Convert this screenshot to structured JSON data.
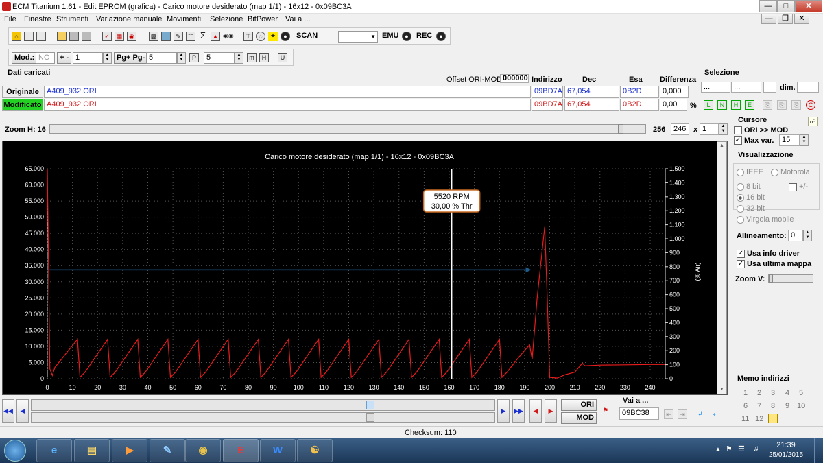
{
  "window": {
    "title": "ECM Titanium 1.61 - Edit EPROM (grafica) - Carico motore desiderato (map 1/1) - 16x12 - 0x09BC3A"
  },
  "menu": [
    "File",
    "Finestre",
    "Strumenti",
    "Variazione manuale",
    "Movimenti",
    "Selezione",
    "BitPower",
    "Vai a ..."
  ],
  "toolbar1": {
    "scan_label": "SCAN",
    "emu_label": "EMU",
    "rec_label": "REC"
  },
  "toolbar2": {
    "mod_label": "Mod.:",
    "mod_value": "NO",
    "plusminus_label": "+ -",
    "plusminus_value": "1",
    "pg_label": "Pg+ Pg-",
    "pg_value": "5",
    "p_value": "5"
  },
  "loaded": {
    "title": "Dati caricati",
    "offset_label": "Offset ORI-MOD",
    "offset_value": "000000",
    "col_address": "Indirizzo",
    "col_dec": "Dec",
    "col_hex": "Esa",
    "col_diff": "Differenza",
    "orig_label": "Originale",
    "orig_file": "A409_932.ORI",
    "orig_address": "09BD7A",
    "orig_dec": "67,054",
    "orig_hex": "0B2D",
    "orig_diff": "0,000",
    "mod_label": "Modificato",
    "mod_file": "A409_932.ORI",
    "mod_address": "09BD7A",
    "mod_dec": "67,054",
    "mod_hex": "0B2D",
    "mod_diff": "0,00",
    "mod_unit": "%"
  },
  "selection": {
    "title": "Selezione",
    "f1": "...",
    "f2": "...",
    "dim_label": "dim."
  },
  "zoom": {
    "label": "Zoom H: 16",
    "value_a": "256",
    "value_b": "246",
    "x_label": "x",
    "mult": "1"
  },
  "cursor": {
    "title": "Cursore",
    "ori_mod_label": "ORI >> MOD",
    "max_var_label": "Max var.",
    "max_var_value": "15"
  },
  "view": {
    "title": "Visualizzazione",
    "ieee": "IEEE",
    "motorola": "Motorola",
    "bit8": "8 bit",
    "plusminus": "+/-",
    "bit16": "16 bit",
    "bit32": "32 bit",
    "float": "Virgola mobile",
    "align_label": "Allineamento:",
    "align_value": "0",
    "driver_info": "Usa info driver",
    "last_map": "Usa ultima mappa",
    "zoomv_label": "Zoom V:"
  },
  "memo": {
    "title": "Memo indirizzi",
    "items": [
      "1",
      "2",
      "3",
      "4",
      "5",
      "6",
      "7",
      "8",
      "9",
      "10",
      "11",
      "12"
    ]
  },
  "bottom": {
    "vai_label": "Vai a ...",
    "vai_value": "09BC38",
    "ori_btn": "ORI",
    "mod_btn": "MOD",
    "x_min": "210",
    "checksum": "Checksum: 110"
  },
  "taskbar": {
    "time": "21:39",
    "date": "25/01/2015"
  },
  "chart_data": {
    "type": "line",
    "title": "Carico motore desiderato (map 1/1) - 16x12 - 0x09BC3A",
    "xlabel": "",
    "ylabel": "",
    "y2label": "(% Air)",
    "xlim": [
      0,
      246
    ],
    "ylim": [
      0,
      65000
    ],
    "y2lim": [
      0,
      1500
    ],
    "x_ticks": [
      "0",
      "10",
      "20",
      "30",
      "40",
      "50",
      "60",
      "70",
      "80",
      "90",
      "100",
      "110",
      "120",
      "130",
      "140",
      "150",
      "160",
      "170",
      "180",
      "190",
      "200",
      "210",
      "220",
      "230",
      "240"
    ],
    "y_ticks": [
      "0",
      "5.000",
      "10.000",
      "15.000",
      "20.000",
      "25.000",
      "30.000",
      "35.000",
      "40.000",
      "45.000",
      "50.000",
      "55.000",
      "60.000",
      "65.000"
    ],
    "y2_ticks": [
      "0",
      "100",
      "200",
      "300",
      "400",
      "500",
      "600",
      "700",
      "800",
      "900",
      "1.000",
      "1.100",
      "1.200",
      "1.300",
      "1.400",
      "1.500"
    ],
    "cursor": {
      "x": 161,
      "label_rpm": "5520 RPM",
      "label_thr": "30,00 % Thr"
    },
    "reference_line": {
      "y": 33700,
      "x_end": 191
    },
    "series": [
      {
        "color": "#e81c1c",
        "points": [
          [
            0,
            65000
          ],
          [
            1,
            3000
          ],
          [
            2,
            1000
          ],
          [
            3,
            3500
          ],
          [
            12,
            12200
          ],
          [
            13,
            400
          ],
          [
            15,
            2000
          ],
          [
            24,
            12200
          ],
          [
            25,
            400
          ],
          [
            27,
            2000
          ],
          [
            36,
            12200
          ],
          [
            37,
            400
          ],
          [
            39,
            2000
          ],
          [
            48,
            12200
          ],
          [
            49,
            400
          ],
          [
            51,
            2000
          ],
          [
            60,
            12200
          ],
          [
            61,
            400
          ],
          [
            63,
            2000
          ],
          [
            72,
            12200
          ],
          [
            73,
            400
          ],
          [
            75,
            2000
          ],
          [
            84,
            12200
          ],
          [
            85,
            400
          ],
          [
            87,
            2000
          ],
          [
            96,
            12200
          ],
          [
            97,
            400
          ],
          [
            99,
            2000
          ],
          [
            108,
            12200
          ],
          [
            109,
            400
          ],
          [
            111,
            2000
          ],
          [
            120,
            12200
          ],
          [
            121,
            400
          ],
          [
            123,
            2000
          ],
          [
            132,
            12200
          ],
          [
            133,
            400
          ],
          [
            135,
            2000
          ],
          [
            144,
            12200
          ],
          [
            145,
            400
          ],
          [
            147,
            2000
          ],
          [
            156,
            12200
          ],
          [
            157,
            400
          ],
          [
            159,
            2000
          ],
          [
            168,
            12200
          ],
          [
            169,
            400
          ],
          [
            171,
            2000
          ],
          [
            180,
            12200
          ],
          [
            181,
            400
          ],
          [
            183,
            2000
          ],
          [
            187,
            6000
          ],
          [
            192,
            10500
          ],
          [
            193,
            6000
          ],
          [
            195,
            25000
          ],
          [
            198,
            47000
          ],
          [
            199,
            25000
          ],
          [
            200,
            400
          ],
          [
            203,
            200
          ],
          [
            206,
            1200
          ],
          [
            210,
            2000
          ],
          [
            213,
            4800
          ],
          [
            214,
            4000
          ],
          [
            220,
            4200
          ],
          [
            230,
            4300
          ],
          [
            240,
            4400
          ],
          [
            246,
            4400
          ]
        ]
      }
    ]
  }
}
